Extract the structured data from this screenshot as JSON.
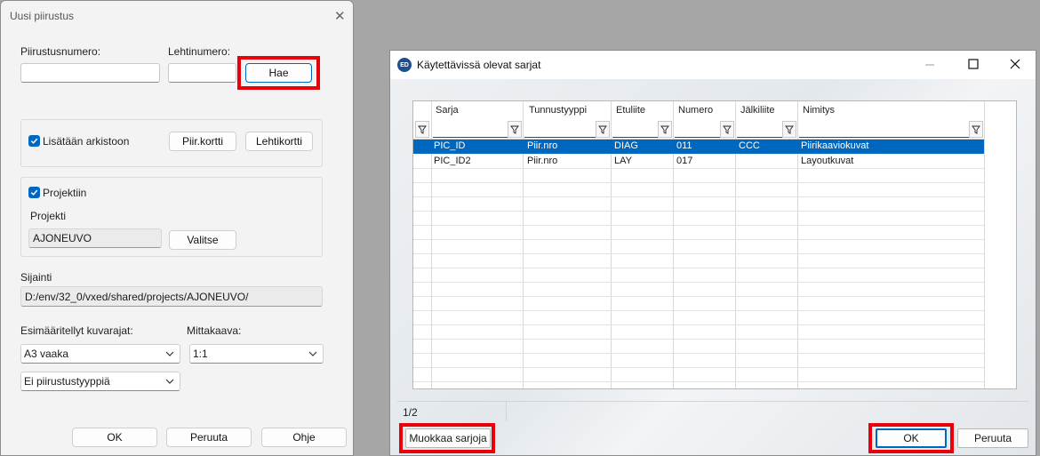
{
  "new_drawing_dialog": {
    "title": "Uusi piirustus",
    "drawing_number_label": "Piirustusnumero:",
    "drawing_number_value": "",
    "sheet_number_label": "Lehtinumero:",
    "sheet_number_value": "",
    "fetch_button": "Hae",
    "archive_checkbox_label": "Lisätään arkistoon",
    "archive_checked": true,
    "drawing_card_button": "Piir.kortti",
    "sheet_card_button": "Lehtikortti",
    "project_checkbox_label": "Projektiin",
    "project_checked": true,
    "project_label": "Projekti",
    "project_value": "AJONEUVO",
    "select_button": "Valitse",
    "location_label": "Sijainti",
    "location_value": "D:/env/32_0/vxed/shared/projects/AJONEUVO/",
    "frames_label": "Esimääritellyt kuvarajat:",
    "frames_value": "A3 vaaka",
    "scale_label": "Mittakaava:",
    "scale_value": "1:1",
    "drawing_type_value": "Ei piirustustyyppiä",
    "ok_button": "OK",
    "cancel_button": "Peruuta",
    "help_button": "Ohje"
  },
  "series_dialog": {
    "title": "Käytettävissä olevat sarjat",
    "app_icon_text": "ED",
    "columns": [
      "Sarja",
      "Tunnustyyppi",
      "Etuliite",
      "Numero",
      "Jälkiliite",
      "Nimitys"
    ],
    "rows": [
      {
        "sarja": "PIC_ID",
        "tunnustyyppi": "Piir.nro",
        "etuliite": "DIAG",
        "numero": "011",
        "jalkiliite": "CCC",
        "nimitys": "Piirikaaviokuvat",
        "selected": true
      },
      {
        "sarja": "PIC_ID2",
        "tunnustyyppi": "Piir.nro",
        "etuliite": "LAY",
        "numero": "017",
        "jalkiliite": "",
        "nimitys": "Layoutkuvat",
        "selected": false
      }
    ],
    "status_text": "1/2",
    "edit_series_button": "Muokkaa sarjoja",
    "ok_button": "OK",
    "cancel_button": "Peruuta"
  },
  "colors": {
    "selection": "#0067c0",
    "highlight": "#e8000b",
    "checkbox": "#0067c0"
  }
}
